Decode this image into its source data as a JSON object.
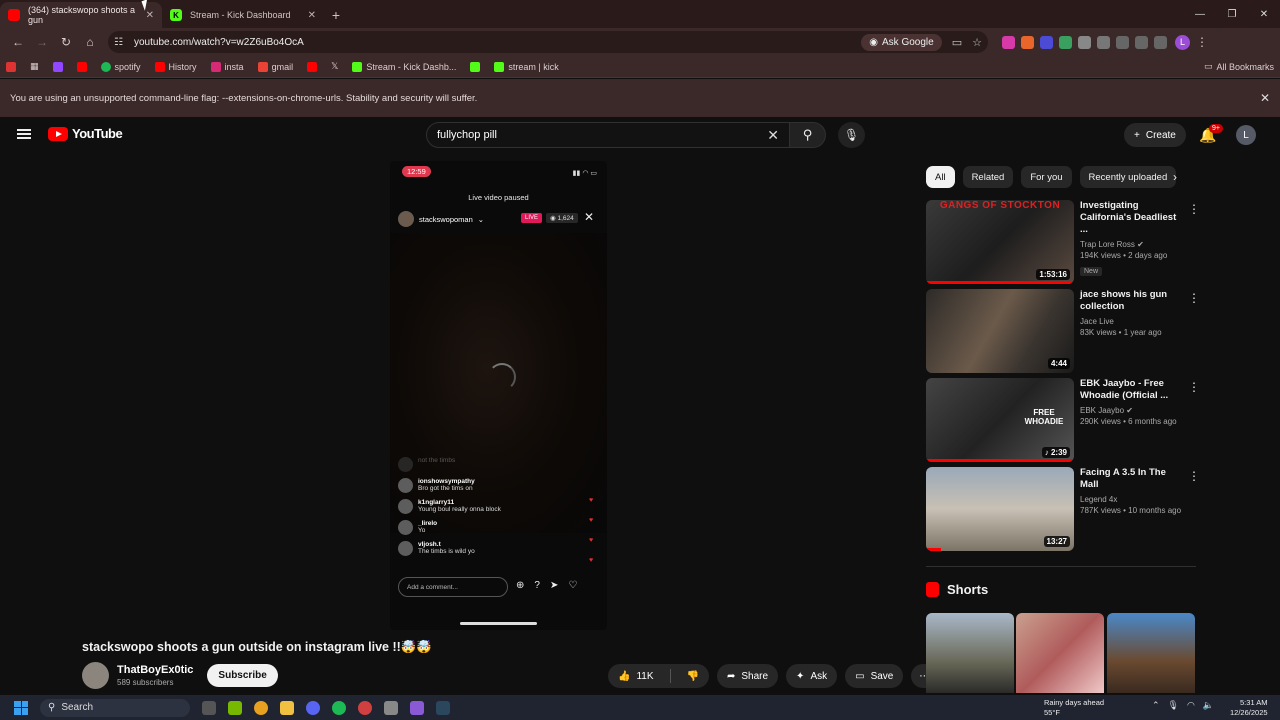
{
  "browser": {
    "tabs": [
      {
        "label": "(364) stackswopo shoots a gun",
        "active": true,
        "fav_color": "#ff0000"
      },
      {
        "label": "Stream - Kick Dashboard",
        "active": false,
        "fav_color": "#53fc18"
      }
    ],
    "url": "youtube.com/watch?v=w2Z6uBo4OcA",
    "ask_google": "Ask Google",
    "bookmarks": [
      "spotify",
      "History",
      "insta",
      "gmail",
      "Stream - Kick Dashb...",
      "stream | kick"
    ],
    "all_bookmarks": "All Bookmarks",
    "warning": "You are using an unsupported command-line flag: --extensions-on-chrome-urls. Stability and security will suffer.",
    "profile_initial": "L"
  },
  "youtube": {
    "logo_text": "YouTube",
    "search_value": "fullychop pill",
    "create_label": "Create",
    "notif_badge": "9+",
    "avatar_initial": "L"
  },
  "player": {
    "time": "12:59",
    "paused_text": "Live video paused",
    "username": "stackswopoman",
    "live_label": "LIVE",
    "viewers": "1,624",
    "comments": [
      {
        "name": "",
        "text": "not the timbs",
        "faded": true
      },
      {
        "name": "ionshowsympathy",
        "text": "Bro got the tims on"
      },
      {
        "name": "k1nglarry11",
        "text": "Young boul really onna block"
      },
      {
        "name": "_lirelo",
        "text": "Yo"
      },
      {
        "name": "vljosh.t",
        "text": "The timbs is wild yo"
      }
    ],
    "comment_placeholder": "Add a comment..."
  },
  "video": {
    "title": "stackswopo shoots a gun outside on instagram live !!🤯🤯",
    "channel": "ThatBoyEx0tic",
    "subscribers": "589 subscribers",
    "subscribe_label": "Subscribe",
    "likes": "11K",
    "share_label": "Share",
    "ask_label": "Ask",
    "save_label": "Save"
  },
  "sidebar": {
    "chips": [
      "All",
      "Related",
      "For you",
      "Recently uploaded"
    ],
    "recommendations": [
      {
        "title": "Investigating California's Deadliest ...",
        "channel": "Trap Lore Ross",
        "meta": "194K views • 2 days ago",
        "duration": "1:53:16",
        "badge": "New",
        "verified": true,
        "thumb_text": "GANGS OF STOCKTON",
        "progress": 1.0
      },
      {
        "title": "jace shows his gun collection",
        "channel": "Jace Live",
        "meta": "83K views • 1 year ago",
        "duration": "4:44",
        "badge": "",
        "verified": false,
        "thumb_text": "",
        "progress": 0
      },
      {
        "title": "EBK Jaaybo - Free Whoadie (Official ...",
        "channel": "EBK Jaaybo",
        "meta": "290K views • 6 months ago",
        "duration": "2:39",
        "badge": "",
        "verified": true,
        "thumb_text": "FREE WHOADIE",
        "progress": 1.0
      },
      {
        "title": "Facing A 3.5 In The Mall",
        "channel": "Legend 4x",
        "meta": "787K views • 10 months ago",
        "duration": "13:27",
        "badge": "",
        "verified": false,
        "thumb_text": "",
        "progress": 0.1
      }
    ],
    "shorts_title": "Shorts"
  },
  "taskbar": {
    "search_label": "Search",
    "weather_line1": "Rainy days ahead",
    "weather_line2": "55°F",
    "time": "5:31 AM",
    "date": "12/26/2025"
  }
}
